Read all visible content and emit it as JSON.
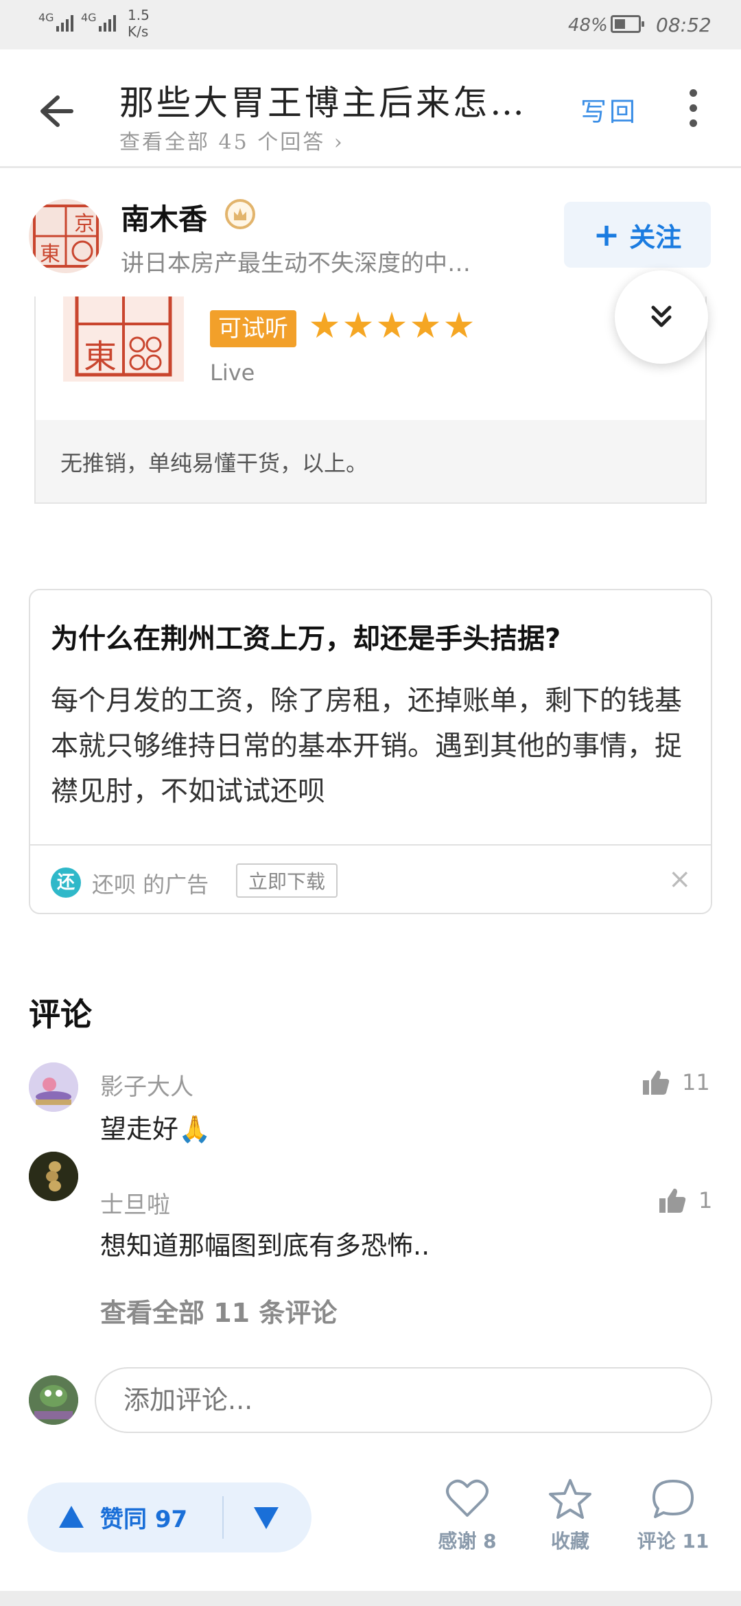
{
  "status_bar": {
    "signal_1": "4G",
    "signal_2": "4G",
    "net_speed_value": "1.5",
    "net_speed_unit": "K/s",
    "battery": "48%",
    "battery_level": 0.48,
    "time": "08:52"
  },
  "header": {
    "title": "那些大胃王博主后来怎…",
    "subtitle": "查看全部 45 个回答",
    "subtitle_chevron": "›",
    "write_answer": "写回",
    "icons": [
      "back-arrow-icon",
      "more-vertical-icon"
    ]
  },
  "author": {
    "name": "南木香",
    "description": "讲日本房产最生动不失深度的中…",
    "follow_plus": "+",
    "follow_label": "关注",
    "avatar_glyphs": [
      "京",
      "東"
    ]
  },
  "live_card": {
    "tag": "可试听",
    "rating_stars": 5,
    "kind": "Live",
    "summary": "无推销，单纯易懂干货，以上。"
  },
  "ad": {
    "title": "为什么在荆州工资上万，却还是手头拮据?",
    "body": "每个月发的工资，除了房租，还掉账单，剩下的钱基本就只够维持日常的基本开销。遇到其他的事情，捉襟见肘，不如试试还呗",
    "icon_char": "还",
    "source": "还呗 的广告",
    "download_label": "立即下载",
    "close": "×"
  },
  "comments": {
    "heading": "评论",
    "items": [
      {
        "author": "影子大人",
        "text": "望走好🙏",
        "likes": "11"
      },
      {
        "author": "士旦啦",
        "text": "想知道那幅图到底有多恐怖..",
        "likes": "1"
      }
    ],
    "view_all": "查看全部 11 条评论",
    "input_placeholder": "添加评论..."
  },
  "bottom_bar": {
    "vote_up": "赞同 97",
    "thanks": "感谢 8",
    "favorite": "收藏",
    "comment": "评论 11"
  },
  "colors": {
    "accent": "#1a7be0",
    "vote_bg": "#e8f1fc",
    "star": "#f5a623",
    "tag": "#f2a02a"
  }
}
